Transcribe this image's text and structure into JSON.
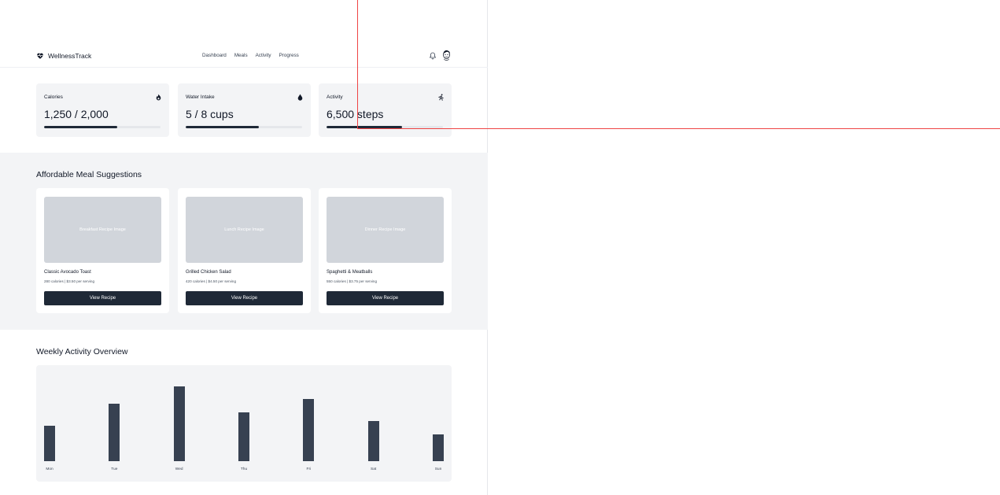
{
  "header": {
    "brand": "WellnessTrack",
    "nav": [
      "Dashboard",
      "Meals",
      "Activity",
      "Progress"
    ]
  },
  "stats": [
    {
      "label": "Calories",
      "value": "1,250 / 2,000",
      "progress": 0.625,
      "icon": "fire-icon"
    },
    {
      "label": "Water Intake",
      "value": "5 / 8 cups",
      "progress": 0.625,
      "icon": "water-drop-icon"
    },
    {
      "label": "Activity",
      "value": "6,500 steps",
      "progress": 0.65,
      "icon": "running-icon"
    }
  ],
  "meals": {
    "title": "Affordable Meal Suggestions",
    "items": [
      {
        "image_label": "Breakfast Recipe Image",
        "name": "Classic Avocado Toast",
        "meta": "280 calories | $3.50 per serving",
        "button": "View Recipe"
      },
      {
        "image_label": "Lunch Recipe Image",
        "name": "Grilled Chicken Salad",
        "meta": "420 calories | $4.50 per serving",
        "button": "View Recipe"
      },
      {
        "image_label": "Dinner Recipe Image",
        "name": "Spaghetti & Meatballs",
        "meta": "550 calories | $3.75 per serving",
        "button": "View Recipe"
      }
    ]
  },
  "activity": {
    "title": "Weekly Activity Overview"
  },
  "chart_data": {
    "type": "bar",
    "categories": [
      "Mon",
      "Tue",
      "Wed",
      "Thu",
      "Fri",
      "Sat",
      "Sun"
    ],
    "values": [
      45,
      73,
      95,
      62,
      79,
      51,
      34
    ],
    "ylim": [
      0,
      100
    ],
    "grid": false
  },
  "colors": {
    "accent": "#1f2937",
    "card_bg": "#f3f4f6",
    "image_placeholder": "#d1d5db",
    "overlay_outline": "#ef4444"
  }
}
